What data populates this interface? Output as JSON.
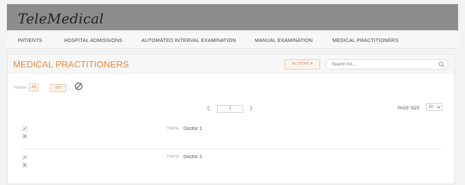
{
  "app": {
    "title": "TeleMedical"
  },
  "nav": {
    "items": [
      {
        "label": "PATIENTS"
      },
      {
        "label": "HOSPITAL ADMISSIONS"
      },
      {
        "label": "AUTOMATED INTERVAL EXAMINATION"
      },
      {
        "label": "MANUAL EXAMINATION"
      },
      {
        "label": "MEDICAL PRACTITIONERS"
      }
    ]
  },
  "panel": {
    "title": "MEDICAL PRACTITIONERS",
    "actions_label": "ACTIONS ▾",
    "search": {
      "placeholder": "Search for...",
      "value": ""
    }
  },
  "filter": {
    "label": "Name",
    "all_label": "All",
    "go_label": "GO"
  },
  "pager": {
    "current_page": "1",
    "page_size_label": "PAGE SIZE",
    "page_size_value": "10"
  },
  "records": [
    {
      "field_label": "Name",
      "value": "Doctor 1"
    },
    {
      "field_label": "Name",
      "value": "Doctor 2"
    }
  ],
  "colors": {
    "accent": "#e8883a",
    "header_bg": "#8c8c8c"
  },
  "icons": {
    "search": "magnifier",
    "clear": "no-entry-circle",
    "prev": "chevron-left",
    "next": "chevron-right",
    "edit": "pencil",
    "delete": "x-mark"
  }
}
